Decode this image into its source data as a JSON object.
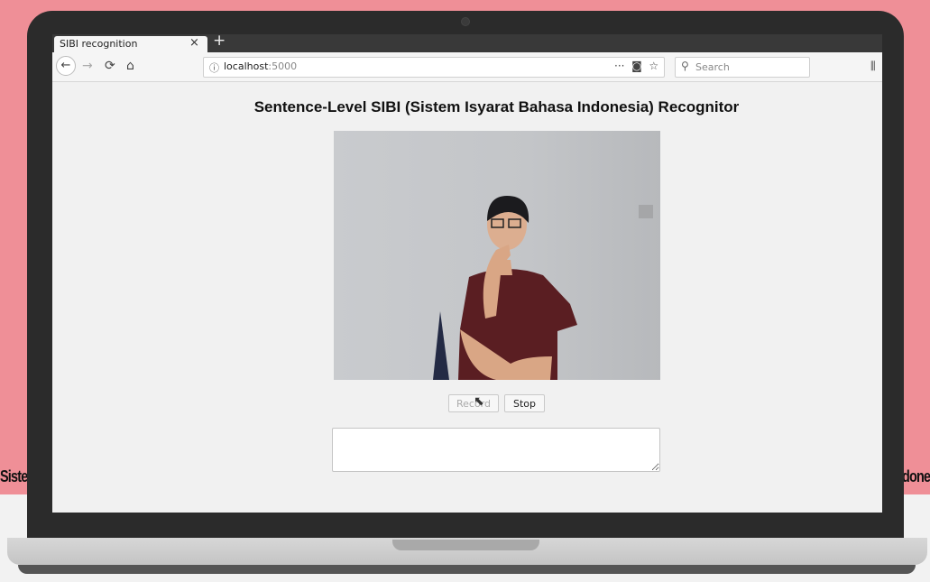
{
  "browser": {
    "tab_title": "SIBI recognition",
    "tab_close_icon": "close-icon",
    "new_tab_symbol": "+",
    "url_host": "localhost",
    "url_port": ":5000",
    "page_actions": "···",
    "search_placeholder": "Search",
    "icons": {
      "back": "back-arrow-icon",
      "forward": "forward-arrow-icon",
      "reload": "reload-icon",
      "home": "home-icon",
      "info": "info-icon",
      "pocket": "pocket-icon",
      "bookmark": "star-icon",
      "search": "search-icon",
      "library": "library-icon"
    }
  },
  "page": {
    "title": "Sentence-Level SIBI (Sistem Isyarat Bahasa Indonesia) Recognitor",
    "record_label": "Record",
    "stop_label": "Stop",
    "output_value": ""
  },
  "background": {
    "left_fragment": "Siste",
    "right_fragment": "done"
  },
  "colors": {
    "background_pink": "#ef8f97",
    "laptop_bezel": "#2b2b2b",
    "page_bg": "#f1f1f1"
  }
}
